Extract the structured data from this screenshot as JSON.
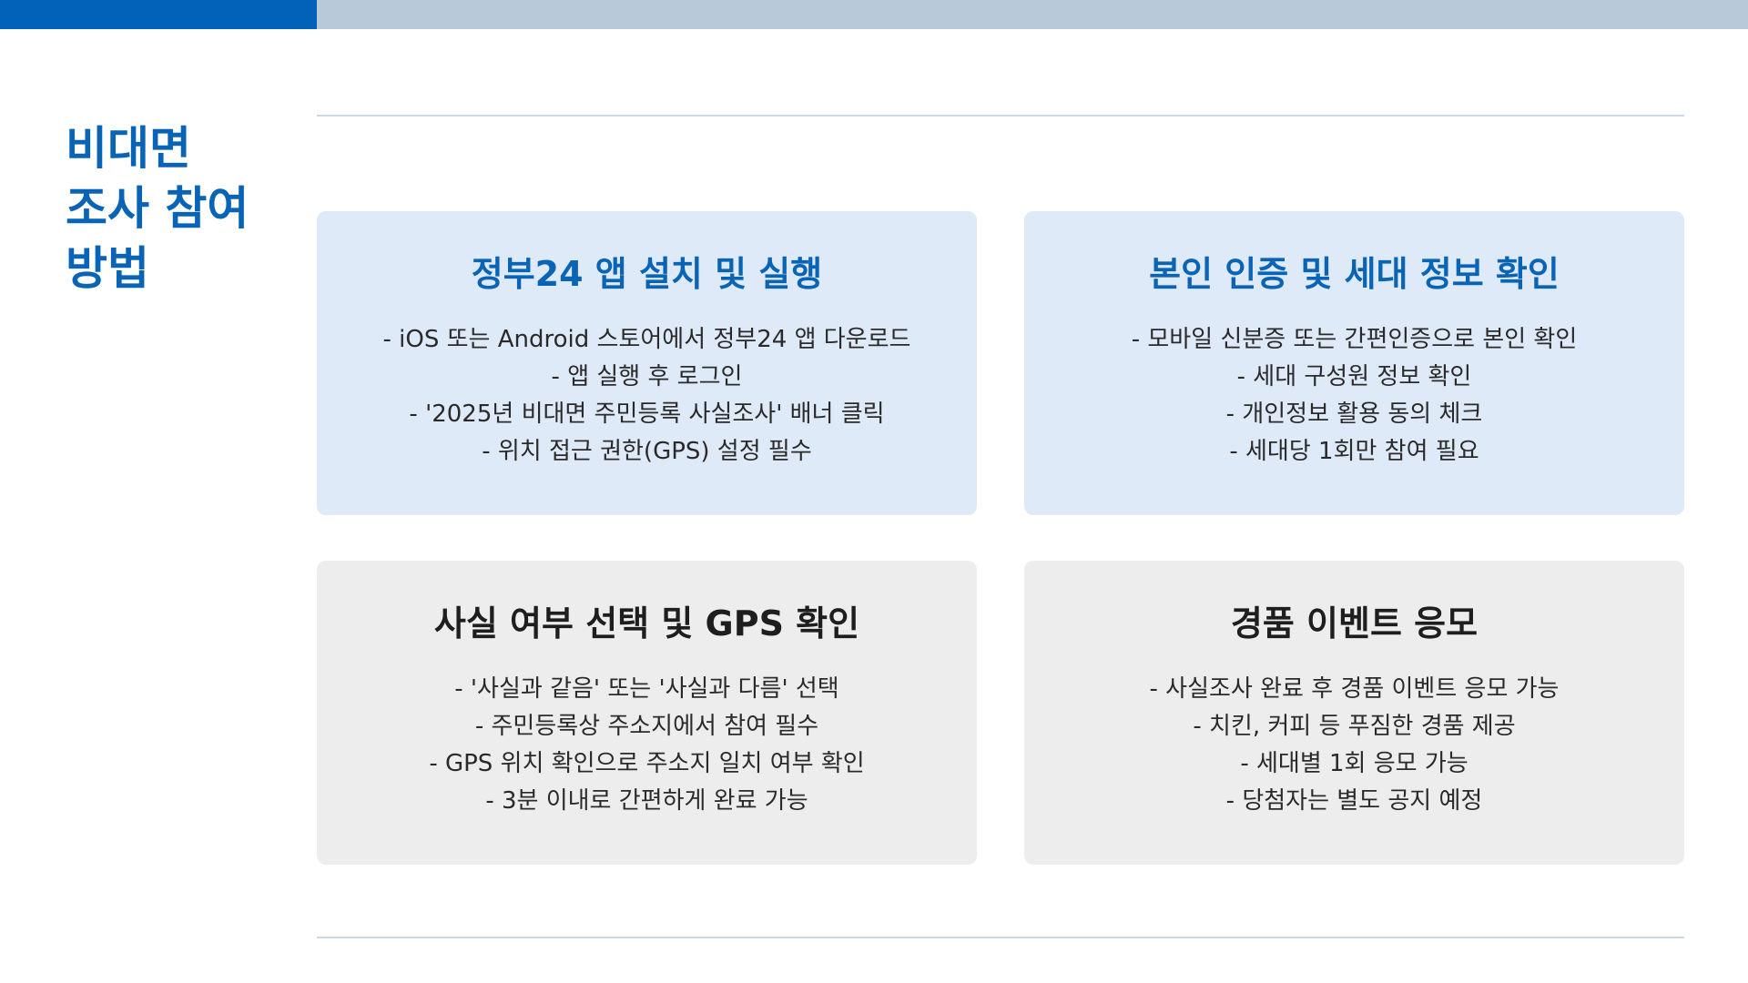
{
  "progress": {
    "value": 0.181,
    "color": "#0261b8"
  },
  "title": "비대면 조사 참여 방법",
  "cards": [
    {
      "title": "정부24 앱 설치 및 실행",
      "items": [
        "- iOS 또는 Android 스토어에서 정부24 앱 다운로드",
        "- 앱 실행 후 로그인",
        "- '2025년 비대면 주민등록 사실조사' 배너 클릭",
        "- 위치 접근 권한(GPS) 설정 필수"
      ]
    },
    {
      "title": "본인 인증 및 세대 정보 확인",
      "items": [
        "- 모바일 신분증 또는 간편인증으로 본인 확인",
        "- 세대 구성원 정보 확인",
        "- 개인정보 활용 동의 체크",
        "- 세대당 1회만 참여 필요"
      ]
    },
    {
      "title": "사실 여부 선택 및 GPS 확인",
      "items": [
        "- '사실과 같음' 또는 '사실과 다름' 선택",
        "- 주민등록상 주소지에서 참여 필수",
        "- GPS 위치 확인으로 주소지 일치 여부 확인",
        "- 3분 이내로 간편하게 완료 가능"
      ]
    },
    {
      "title": "경품 이벤트 응모",
      "items": [
        "- 사실조사 완료 후 경품 이벤트 응모 가능",
        "- 치킨, 커피 등 푸짐한 경품 제공",
        "- 세대별 1회 응모 가능",
        "- 당첨자는 별도 공지 예정"
      ]
    }
  ]
}
